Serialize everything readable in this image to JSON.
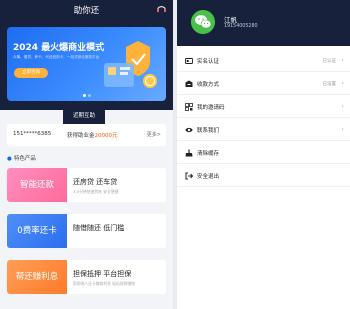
{
  "home": {
    "title": "助你还",
    "banner": {
      "title": "2024 最火爆商业模式",
      "subtitle": "众筹、借贷、养卡、代还信用卡、一站式综合服务平台",
      "button": "立即咨询"
    },
    "recent_label": "近期互助",
    "notice": {
      "phone": "151*****6385",
      "gain_prefix": "获得助业金",
      "amount": "20000元",
      "more": "更多>"
    },
    "featured_label": "特色产品",
    "products": [
      {
        "badge": "智能还款",
        "badge_color": "#ff7bb0",
        "title": "还房贷 还车贷",
        "desc": "3-5分钟快速到账 安全便捷"
      },
      {
        "badge": "0费率还卡",
        "badge_color": "#3a7cf5",
        "title": "随借随还 低门槛",
        "desc": ""
      },
      {
        "badge": "帮还赚利息",
        "badge_color": "#ff8a3d",
        "title": "担保抵押 平台担保",
        "desc": "帮助他人还卡赚取利息 轻松理财赚钱"
      }
    ]
  },
  "profile": {
    "name": "江帆",
    "phone": "19154005280",
    "menu": [
      {
        "icon": "id-card-icon",
        "label": "实名认证",
        "status": "已认证",
        "arrow": "›"
      },
      {
        "icon": "card-icon",
        "label": "收款方式",
        "status": "已设置",
        "arrow": "›"
      },
      {
        "icon": "qrcode-icon",
        "label": "我的邀请码",
        "status": "",
        "arrow": "›"
      },
      {
        "icon": "eye-icon",
        "label": "联系我们",
        "status": "",
        "arrow": "›"
      },
      {
        "icon": "broom-icon",
        "label": "清除缓存",
        "status": "",
        "arrow": ""
      },
      {
        "icon": "logout-icon",
        "label": "安全退出",
        "status": "",
        "arrow": ""
      }
    ]
  }
}
